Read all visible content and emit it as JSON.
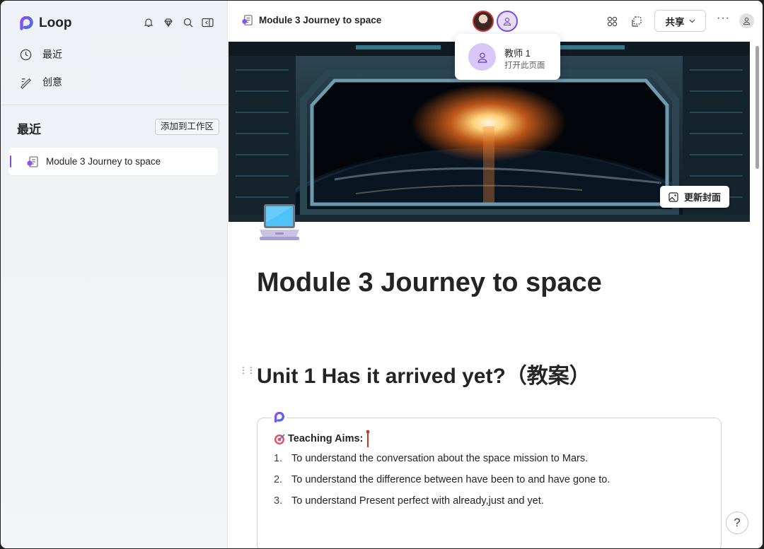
{
  "app": {
    "name": "Loop"
  },
  "sidebar": {
    "nav": [
      {
        "label": "最近",
        "icon": "clock-icon"
      },
      {
        "label": "创意",
        "icon": "ideas-icon"
      }
    ],
    "section_title": "最近",
    "add_to_workspace": "添加到工作区",
    "recent_items": [
      {
        "label": "Module 3 Journey to space",
        "icon": "loop-page-icon"
      }
    ]
  },
  "header": {
    "doc_title": "Module 3 Journey to space",
    "share_label": "共享",
    "more_label": "···"
  },
  "tooltip": {
    "name": "教师 1",
    "action": "打开此页面"
  },
  "cover": {
    "update_label": "更新封面"
  },
  "content": {
    "title": "Module 3 Journey to space",
    "unit_heading": "Unit 1 Has it arrived yet?（教案）",
    "aims_heading": "Teaching Aims:",
    "aims": [
      {
        "num": "1.",
        "text": "To understand the conversation about the space mission to Mars."
      },
      {
        "num": "2.",
        "text": "To understand the difference between have been to and have gone to."
      },
      {
        "num": "3.",
        "text": "To understand Present perfect with already,just and yet."
      }
    ]
  },
  "help_label": "?",
  "colors": {
    "accent": "#7b4ae2",
    "presence_red": "#d13438",
    "text": "#242424"
  }
}
